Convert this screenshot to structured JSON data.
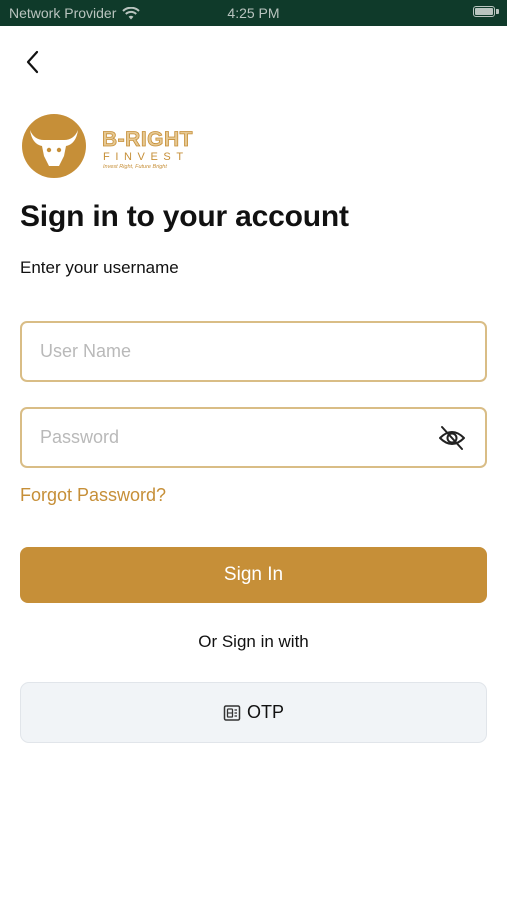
{
  "status_bar": {
    "carrier": "Network Provider",
    "time": "4:25 PM"
  },
  "logo": {
    "brand_line1": "B-RIGHT",
    "brand_line2": "FINVEST",
    "tagline": "Invest Right, Future Bright"
  },
  "header": {
    "title": "Sign in to your account",
    "subtitle": "Enter your username"
  },
  "form": {
    "username_placeholder": "User Name",
    "username_value": "",
    "password_placeholder": "Password",
    "password_value": "",
    "forgot_label": "Forgot Password?",
    "signin_label": "Sign In"
  },
  "alt_signin": {
    "prompt": "Or Sign in with",
    "otp_label": "OTP"
  },
  "colors": {
    "accent": "#c68f38",
    "field_border": "#d9bd86",
    "status_bar_bg": "#0f3a2a",
    "otp_bg": "#f1f4f7"
  }
}
